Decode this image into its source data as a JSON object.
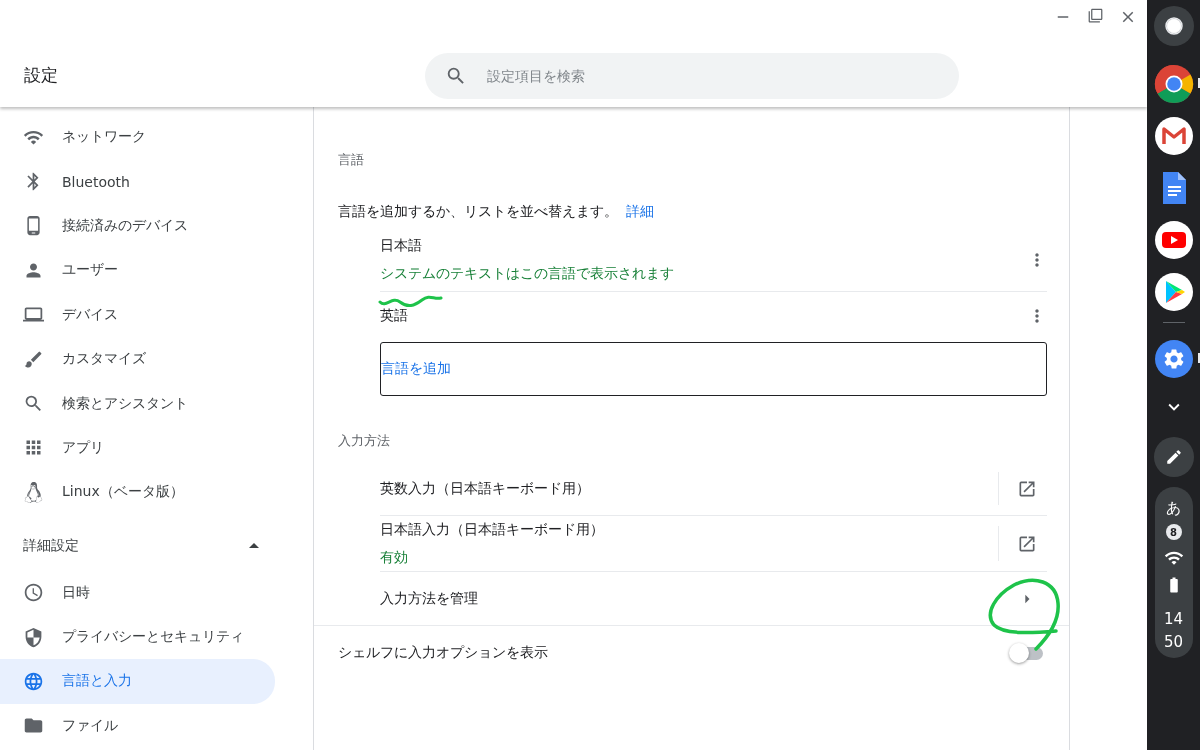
{
  "window": {
    "title": "設定"
  },
  "search": {
    "placeholder": "設定項目を検索"
  },
  "sidebar": {
    "items": [
      {
        "label": "ネットワーク",
        "selected": false
      },
      {
        "label": "Bluetooth",
        "selected": false
      },
      {
        "label": "接続済みのデバイス",
        "selected": false
      },
      {
        "label": "ユーザー",
        "selected": false
      },
      {
        "label": "デバイス",
        "selected": false
      },
      {
        "label": "カスタマイズ",
        "selected": false
      },
      {
        "label": "検索とアシスタント",
        "selected": false
      },
      {
        "label": "アプリ",
        "selected": false
      },
      {
        "label": "Linux（ベータ版）",
        "selected": false
      }
    ],
    "advanced": {
      "label": "詳細設定",
      "expanded": true,
      "items": [
        {
          "label": "日時",
          "selected": false
        },
        {
          "label": "プライバシーとセキュリティ",
          "selected": false
        },
        {
          "label": "言語と入力",
          "selected": true
        },
        {
          "label": "ファイル",
          "selected": false
        }
      ]
    }
  },
  "languages": {
    "heading": "言語",
    "description": "言語を追加するか、リストを並べ替えます。",
    "link": "詳細",
    "items": [
      {
        "name": "日本語",
        "note": "システムのテキストはこの言語で表示されます"
      },
      {
        "name": "英語"
      }
    ],
    "add_button": "言語を追加"
  },
  "input_methods": {
    "heading": "入力方法",
    "items": [
      {
        "name": "英数入力（日本語キーボード用）"
      },
      {
        "name": "日本語入力（日本語キーボード用）",
        "status": "有効"
      }
    ],
    "manage": "入力方法を管理"
  },
  "shelf_option": {
    "label": "シェルフに入力オプションを表示",
    "on": false
  },
  "shelf": {
    "apps": [
      {
        "kind": "chrome",
        "running": true
      },
      {
        "kind": "gmail",
        "running": false
      },
      {
        "kind": "docs",
        "running": false
      },
      {
        "kind": "youtube",
        "running": false
      },
      {
        "kind": "play",
        "running": false
      },
      {
        "kind": "settings",
        "running": true
      }
    ],
    "ime": "あ",
    "notifications": "8",
    "hour": "14",
    "minute": "50"
  }
}
